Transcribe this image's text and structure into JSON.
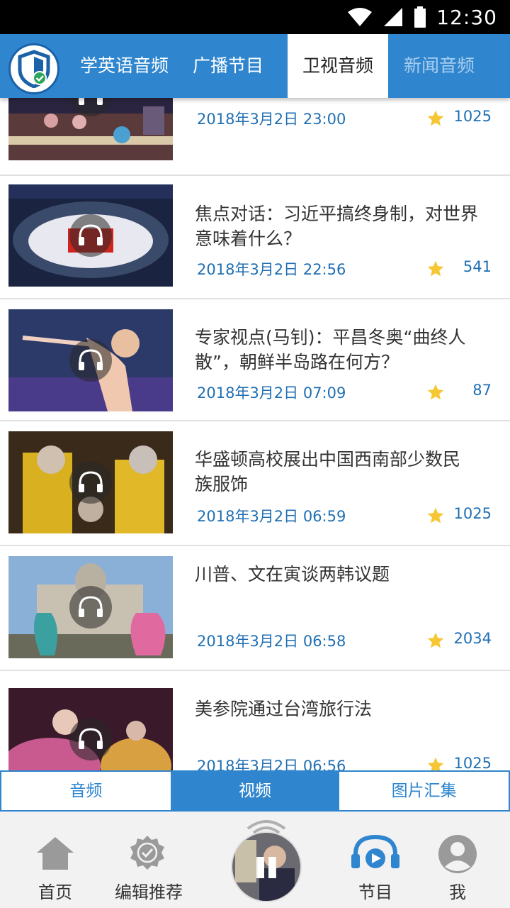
{
  "status_bar": {
    "time": "12:30"
  },
  "top_tabs": [
    {
      "label": "学英语音频",
      "active": false
    },
    {
      "label": "广播节目",
      "active": false
    },
    {
      "label": "卫视音频",
      "active": true
    },
    {
      "label": "新闻音频",
      "active": false
    }
  ],
  "items": [
    {
      "title": "",
      "date": "2018年3月2日 23:00",
      "count": "1025"
    },
    {
      "title": "焦点对话：习近平搞终身制，对世界意味着什么？",
      "date": "2018年3月2日 22:56",
      "count": "541"
    },
    {
      "title": "专家视点(马钊)：平昌冬奥“曲终人散”，朝鲜半岛路在何方？",
      "date": "2018年3月2日 07:09",
      "count": "87"
    },
    {
      "title": "华盛顿高校展出中国西南部少数民族服饰",
      "date": "2018年3月2日 06:59",
      "count": "1025"
    },
    {
      "title": "川普、文在寅谈两韩议题",
      "date": "2018年3月2日 06:58",
      "count": "2034"
    },
    {
      "title": "美参院通过台湾旅行法",
      "date": "2018年3月2日 06:56",
      "count": "1025"
    }
  ],
  "segments": [
    {
      "label": "音频",
      "active": false
    },
    {
      "label": "视频",
      "active": true
    },
    {
      "label": "图片汇集",
      "active": false
    }
  ],
  "bottom_nav": {
    "home": "首页",
    "editor_picks": "编辑推荐",
    "programs": "节目",
    "me": "我"
  },
  "colors": {
    "brand_blue": "#2f86cf",
    "date_blue": "#1f6fb3",
    "star": "#f6c634"
  }
}
